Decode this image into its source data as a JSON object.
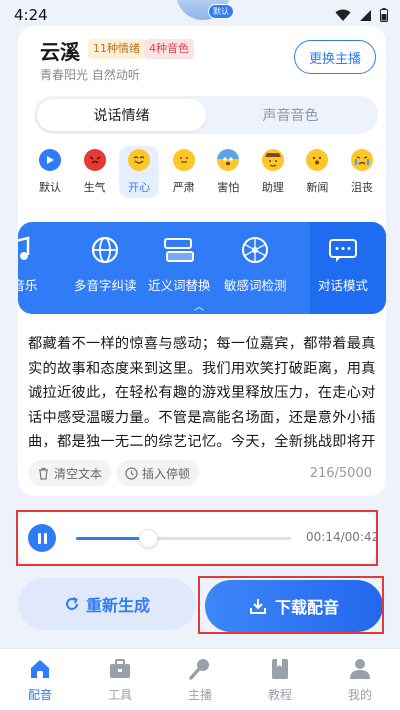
{
  "status_bar": {
    "time": "4:24"
  },
  "avatar_badge": "默认",
  "voice": {
    "name": "云溪",
    "emotion_tag": "11种情绪",
    "tone_tag": "4种音色",
    "description": "青春阳光 自然动听",
    "change_button": "更换主播"
  },
  "tabs": [
    {
      "label": "说话情绪",
      "active": true
    },
    {
      "label": "声音音色",
      "active": false
    }
  ],
  "emotions": [
    {
      "label": "默认",
      "icon": "play-circle-icon"
    },
    {
      "label": "生气",
      "icon": "angry-face-icon"
    },
    {
      "label": "开心",
      "icon": "happy-face-icon",
      "active": true
    },
    {
      "label": "严肃",
      "icon": "serious-face-icon"
    },
    {
      "label": "害怕",
      "icon": "scared-face-icon"
    },
    {
      "label": "助理",
      "icon": "assistant-face-icon"
    },
    {
      "label": "新闻",
      "icon": "news-face-icon"
    },
    {
      "label": "沮丧",
      "icon": "sad-face-icon"
    }
  ],
  "tools": [
    {
      "label": "背景音乐",
      "visible_label": "景音乐",
      "icon": "music-note-icon"
    },
    {
      "label": "多音字纠读",
      "icon": "globe-icon"
    },
    {
      "label": "近义词替换",
      "icon": "swap-icon"
    },
    {
      "label": "敏感词检测",
      "icon": "network-icon"
    },
    {
      "label": "对话模式",
      "icon": "chat-bubbles-icon"
    }
  ],
  "text_body": "都藏着不一样的惊喜与感动；每一位嘉宾，都带着最真实的故事和态度来到这里。我们用欢笑打破距离，用真诚拉近彼此，在轻松有趣的游戏里释放压力，在走心对话中感受温暖力量。不管是高能名场面，还是意外小插曲，都是独一无二的综艺记忆。今天，全新挑战即将开",
  "actions": {
    "clear": "清空文本",
    "pause": "插入停顿"
  },
  "counter": "216/5000",
  "player": {
    "time": "00:14/00:42",
    "progress": 0.333
  },
  "buttons": {
    "regenerate": "重新生成",
    "download": "下载配音"
  },
  "nav": [
    {
      "label": "配音",
      "icon": "home-icon",
      "active": true
    },
    {
      "label": "工具",
      "icon": "toolbox-icon"
    },
    {
      "label": "主播",
      "icon": "microphone-icon"
    },
    {
      "label": "教程",
      "icon": "book-icon"
    },
    {
      "label": "我的",
      "icon": "profile-icon"
    }
  ],
  "colors": {
    "accent": "#2f7cf6",
    "highlight_outline": "#e53838"
  }
}
